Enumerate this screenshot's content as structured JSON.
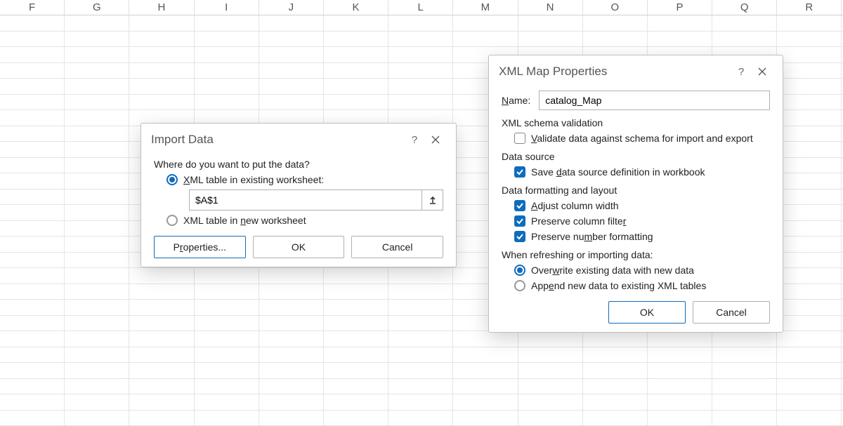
{
  "columns": [
    "F",
    "G",
    "H",
    "I",
    "J",
    "K",
    "L",
    "M",
    "N",
    "O",
    "P",
    "Q",
    "R"
  ],
  "row_count": 26,
  "import": {
    "title": "Import Data",
    "prompt": "Where do you want to put the data?",
    "opt1_pre": "",
    "opt1_ul": "X",
    "opt1_post": "ML table in existing worksheet:",
    "cellref": "$A$1",
    "opt2_pre": "XML table in ",
    "opt2_ul": "n",
    "opt2_post": "ew worksheet",
    "btn_props_pre": "P",
    "btn_props_ul": "r",
    "btn_props_post": "operties...",
    "btn_ok": "OK",
    "btn_cancel": "Cancel"
  },
  "xmlprops": {
    "title": "XML Map Properties",
    "name_label_pre": "",
    "name_label_ul": "N",
    "name_label_post": "ame:",
    "name_value": "catalog_Map",
    "sec_validation": "XML schema validation",
    "cb_validate_pre": "",
    "cb_validate_ul": "V",
    "cb_validate_post": "alidate data against schema for import and export",
    "sec_source": "Data source",
    "cb_save_pre": "Save ",
    "cb_save_ul": "d",
    "cb_save_post": "ata source definition in workbook",
    "sec_format": "Data formatting and layout",
    "cb_adjust_pre": "",
    "cb_adjust_ul": "A",
    "cb_adjust_post": "djust column width",
    "cb_filter_pre": "Preserve column filte",
    "cb_filter_ul": "r",
    "cb_filter_post": "",
    "cb_number_pre": "Preserve nu",
    "cb_number_ul": "m",
    "cb_number_post": "ber formatting",
    "sec_refresh": "When refreshing or importing data:",
    "rb_over_pre": "Over",
    "rb_over_ul": "w",
    "rb_over_post": "rite existing data with new data",
    "rb_append_pre": "App",
    "rb_append_ul": "e",
    "rb_append_post": "nd new data to existing XML tables",
    "btn_ok": "OK",
    "btn_cancel": "Cancel"
  }
}
